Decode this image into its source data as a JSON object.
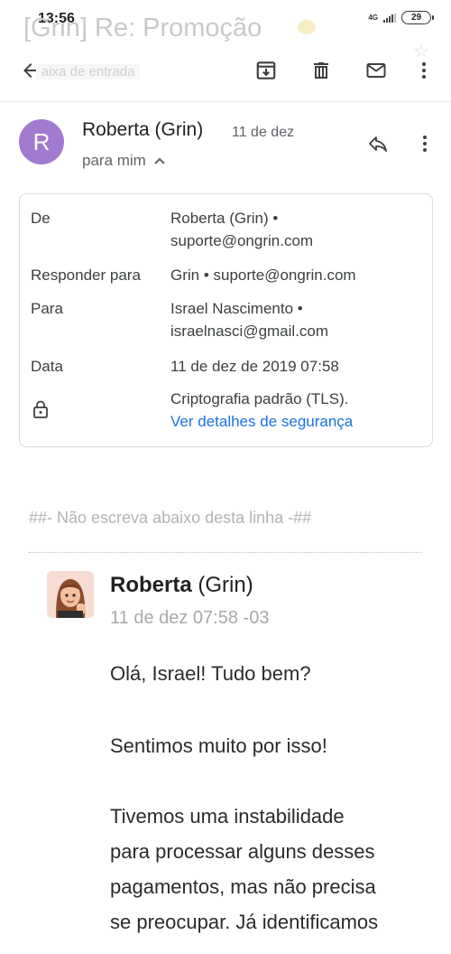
{
  "status_bar": {
    "time": "13:56",
    "network": "4G",
    "battery": "29"
  },
  "header": {
    "subject_faded": "[Grin] Re: Promoção",
    "inbox_label": "aixa de entrada"
  },
  "toolbar": {
    "back_icon": "arrow-left-icon",
    "archive_icon": "archive-icon",
    "delete_icon": "trash-icon",
    "mark_unread_icon": "mail-icon",
    "more_icon": "more-vert-icon"
  },
  "message": {
    "avatar_letter": "R",
    "avatar_color": "#a07bcf",
    "sender": "Roberta (Grin)",
    "date": "11 de dez",
    "to_me": "para mim",
    "details": {
      "from_label": "De",
      "from_name": "Roberta (Grin) •",
      "from_email": "suporte@ongrin.com",
      "reply_label": "Responder para",
      "reply_value": "Grin • suporte@ongrin.com",
      "to_label": "Para",
      "to_name": "Israel Nascimento •",
      "to_email": "israelnasci@gmail.com",
      "date_label": "Data",
      "date_value": "11 de dez de 2019 07:58",
      "security_value": "Criptografia padrão (TLS).",
      "security_link": "Ver detalhes de segurança"
    }
  },
  "body": {
    "separator": "##- Não escreva abaixo desta linha -##",
    "agent_name_bold": "Roberta",
    "agent_name_rest": " (Grin)",
    "agent_time": "11 de dez 07:58 -03",
    "greeting": "Olá, Israel! Tudo bem?",
    "apology": "Sentimos muito por isso!",
    "lines": [
      "Tivemos uma instabilidade",
      "para processar alguns desses",
      "pagamentos, mas não precisa",
      "se preocupar. Já identificamos"
    ]
  },
  "colors": {
    "link": "#1a73e8",
    "icon": "#5f6368",
    "border": "#dadce0"
  }
}
